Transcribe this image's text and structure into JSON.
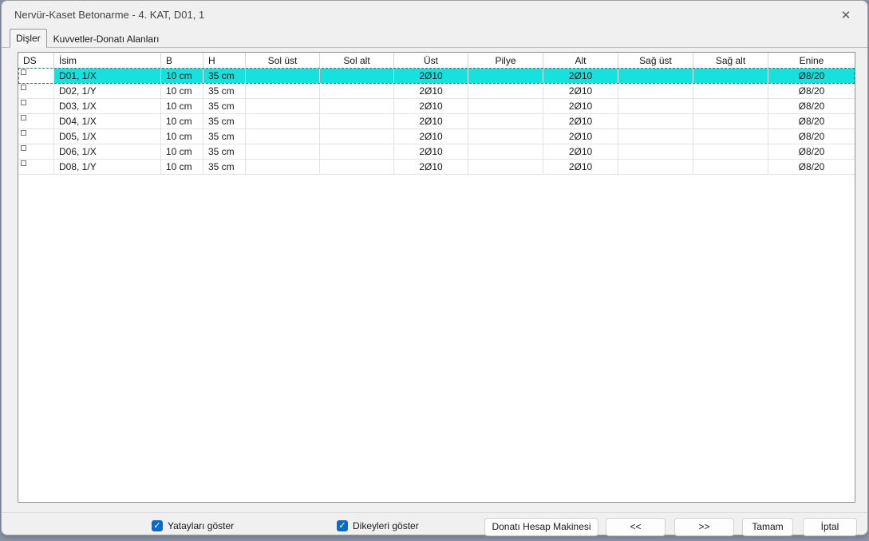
{
  "window": {
    "title": "Nervür-Kaset Betonarme - 4. KAT, D01, 1",
    "close_icon": "✕"
  },
  "tabs": [
    {
      "label": "Dişler",
      "active": true
    },
    {
      "label": "Kuvvetler-Donatı Alanları",
      "active": false
    }
  ],
  "table": {
    "columns": [
      "DS",
      "İsim",
      "B",
      "H",
      "Sol üst",
      "Sol alt",
      "Üst",
      "Pilye",
      "Alt",
      "Sağ üst",
      "Sağ alt",
      "Enine"
    ],
    "rows": [
      {
        "selected": true,
        "cells": [
          "",
          "D01, 1/X",
          "10 cm",
          "35 cm",
          "",
          "",
          "2Ø10",
          "",
          "2Ø10",
          "",
          "",
          "Ø8/20"
        ]
      },
      {
        "selected": false,
        "cells": [
          "",
          "D02, 1/Y",
          "10 cm",
          "35 cm",
          "",
          "",
          "2Ø10",
          "",
          "2Ø10",
          "",
          "",
          "Ø8/20"
        ]
      },
      {
        "selected": false,
        "cells": [
          "",
          "D03, 1/X",
          "10 cm",
          "35 cm",
          "",
          "",
          "2Ø10",
          "",
          "2Ø10",
          "",
          "",
          "Ø8/20"
        ]
      },
      {
        "selected": false,
        "cells": [
          "",
          "D04, 1/X",
          "10 cm",
          "35 cm",
          "",
          "",
          "2Ø10",
          "",
          "2Ø10",
          "",
          "",
          "Ø8/20"
        ]
      },
      {
        "selected": false,
        "cells": [
          "",
          "D05, 1/X",
          "10 cm",
          "35 cm",
          "",
          "",
          "2Ø10",
          "",
          "2Ø10",
          "",
          "",
          "Ø8/20"
        ]
      },
      {
        "selected": false,
        "cells": [
          "",
          "D06, 1/X",
          "10 cm",
          "35 cm",
          "",
          "",
          "2Ø10",
          "",
          "2Ø10",
          "",
          "",
          "Ø8/20"
        ]
      },
      {
        "selected": false,
        "cells": [
          "",
          "D08, 1/Y",
          "10 cm",
          "35 cm",
          "",
          "",
          "2Ø10",
          "",
          "2Ø10",
          "",
          "",
          "Ø8/20"
        ]
      }
    ]
  },
  "footer": {
    "checkboxes": [
      {
        "label": "Yatayları göster",
        "checked": true,
        "check_glyph": "✓"
      },
      {
        "label": "Dikeyleri göster",
        "checked": true,
        "check_glyph": "✓"
      }
    ],
    "buttons": [
      {
        "label": "Donatı Hesap Makinesi"
      },
      {
        "label": "<<"
      },
      {
        "label": ">>"
      },
      {
        "label": "Tamam"
      },
      {
        "label": "İptal"
      }
    ]
  },
  "colors": {
    "row_highlight": "#17e1dc",
    "checkbox_accent": "#0b6bc2",
    "dialog_background": "#f0f0f0"
  }
}
